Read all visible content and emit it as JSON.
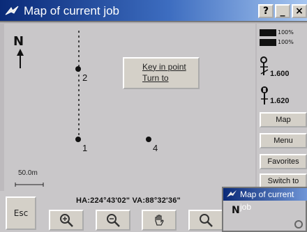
{
  "window": {
    "title": "Map of current job"
  },
  "titlebar_buttons": {
    "help": "?",
    "minimize": "_",
    "close": "×"
  },
  "map": {
    "north_label": "N",
    "popup": {
      "key_in_point": "Key in point",
      "turn_to": "Turn to"
    },
    "points": [
      "1",
      "2",
      "4"
    ],
    "scale_label": "50.0m"
  },
  "bottom": {
    "esc_label": "Esc",
    "angles": "HA:224°43'02\"  VA:88°32'36\"",
    "tools": [
      "zoom-in-icon",
      "zoom-out-icon",
      "pan-icon",
      "zoom-extents-icon"
    ]
  },
  "sidebar": {
    "battery1": "100%",
    "battery2": "100%",
    "target_height": "1.600",
    "instrument_height": "1.620",
    "buttons": [
      "Map",
      "Menu",
      "Favorites",
      "Switch to"
    ]
  },
  "mini_window": {
    "title": "Map of current job",
    "north_label": "N"
  }
}
